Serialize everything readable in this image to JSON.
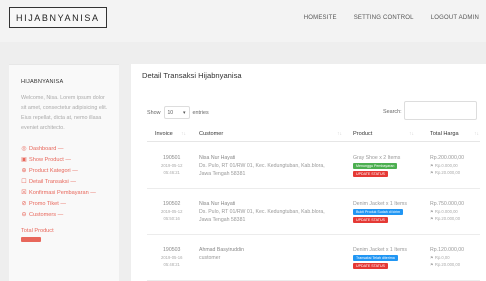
{
  "app": {
    "brand": "HIJABNYANISA"
  },
  "topnav": [
    "HOMESITE",
    "SETTING CONTROL",
    "LOGOUT ADMIN"
  ],
  "sidebar": {
    "title": "HIJABNYANISA",
    "description": "Welcome, Nisa. Lorem ipsum dolor sit amet, consectetur adipisicing elit. Eius repellat, dicta at, nemo illasa eveniet architecto.",
    "menu": [
      {
        "icon": "eye-icon",
        "glyph": "◎",
        "label": "Dashboard —"
      },
      {
        "icon": "box-icon",
        "glyph": "▣",
        "label": "Show Product —"
      },
      {
        "icon": "circle-plus-icon",
        "glyph": "⊕",
        "label": "Product Kategori —"
      },
      {
        "icon": "list-icon",
        "glyph": "☐",
        "label": "Detail Transaksi —"
      },
      {
        "icon": "confirm-icon",
        "glyph": "☒",
        "label": "Konfirmasi Pembayaran —"
      },
      {
        "icon": "tag-icon",
        "glyph": "⊘",
        "label": "Promo Tiket —"
      },
      {
        "icon": "user-icon",
        "glyph": "⊖",
        "label": "Customers —"
      }
    ],
    "total_label": "Total Product"
  },
  "main": {
    "title": "Detail Transaksi Hijabnyanisa",
    "show_label": "Show",
    "show_value": "10",
    "entries_label": "entries",
    "search_label": "Search:",
    "columns": [
      "Invoice",
      "Customer",
      "Product",
      "Total Harga"
    ],
    "rows": [
      {
        "invoice": "190501",
        "date": "2019-05-12",
        "time": "05:46:21",
        "customer_name": "Nisa Nur Hayati",
        "address1": "Ds. Pulo, RT 01/RW 01, Kec. Kedungtuban, Kab.blora,",
        "address2": "Jawa Tengah 58381",
        "product": "Gray Shoe x 2 Items",
        "status1": "Menunggu Pembayaran",
        "status2": "UPDATE STATUS",
        "price": "Rp.200.000,00",
        "price_sub1": "⚑ Rp.0.000,00",
        "price_sub2": "⚑ Rp.20.000,00"
      },
      {
        "invoice": "190502",
        "date": "2019-05-12",
        "time": "05:50:16",
        "customer_name": "Nisa Nur Hayati",
        "address1": "Ds. Pulo, RT 01/RW 01, Kec. Kedungtuban, Kab.blora,",
        "address2": "Jawa Tengah 58381",
        "product": "Denim Jacket x 1 Items",
        "status1": "Bukti Produk Sudah di kirim",
        "status2": "UPDATE STATUS",
        "price": "Rp.750.000,00",
        "price_sub1": "⚑ Rp.0.000,00",
        "price_sub2": "⚑ Rp.20.000,00"
      },
      {
        "invoice": "190503",
        "date": "2019-05-16",
        "time": "05:48:21",
        "customer_name": "Ahmad Basyiruddin",
        "address1": "customer",
        "address2": "",
        "product": "Denim Jacket x 1 Items",
        "status1": "Transaksi Telah diterima",
        "status2": "UPDATE STATUS",
        "price": "Rp.120.000,00",
        "price_sub1": "⚑ Rp.0,00",
        "price_sub2": "⚑ Rp.20.000,00"
      }
    ]
  }
}
